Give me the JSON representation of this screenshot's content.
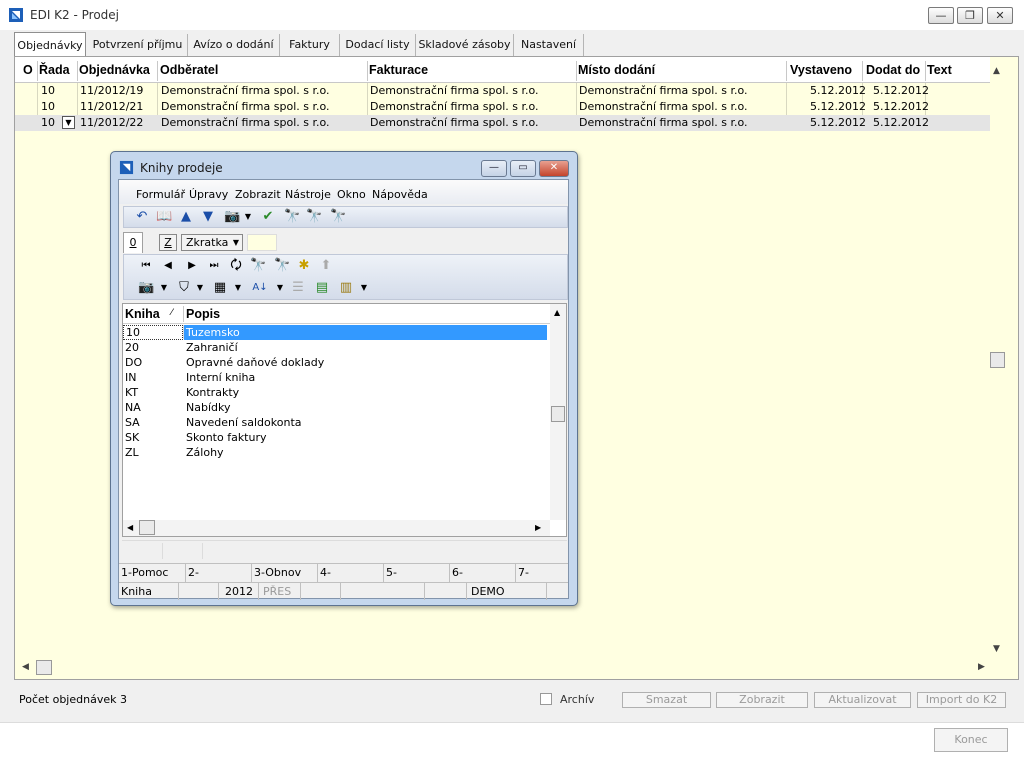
{
  "app": {
    "title": "EDI K2 - Prodej"
  },
  "window_controls": {
    "minimize": "—",
    "restore": "❐",
    "close": "✕"
  },
  "tabs": [
    "Objednávky",
    "Potvrzení příjmu",
    "Avízo o dodání",
    "Faktury",
    "Dodací listy",
    "Skladové zásoby",
    "Nastavení"
  ],
  "grid": {
    "headers": [
      "O",
      "Řada",
      "Objednávka",
      "Odběratel",
      "Fakturace",
      "Místo dodání",
      "Vystaveno",
      "Dodat do",
      "Text"
    ],
    "rows": [
      [
        "",
        "10",
        "11/2012/19",
        "Demonstrační firma spol. s r.o.",
        "Demonstrační firma spol. s r.o.",
        "Demonstrační firma spol. s r.o.",
        "5.12.2012",
        "5.12.2012",
        ""
      ],
      [
        "",
        "10",
        "11/2012/21",
        "Demonstrační firma spol. s r.o.",
        "Demonstrační firma spol. s r.o.",
        "Demonstrační firma spol. s r.o.",
        "5.12.2012",
        "5.12.2012",
        ""
      ],
      [
        "",
        "10",
        "11/2012/22",
        "Demonstrační firma spol. s r.o.",
        "Demonstrační firma spol. s r.o.",
        "Demonstrační firma spol. s r.o.",
        "5.12.2012",
        "5.12.2012",
        ""
      ]
    ]
  },
  "status": {
    "count": "Počet objednávek 3",
    "archiv": "Archív"
  },
  "actions": {
    "smazat": "Smazat",
    "zobrazit": "Zobrazit",
    "aktualizovat": "Aktualizovat",
    "import": "Import do K2"
  },
  "konec": "Konec",
  "dialog": {
    "title": "Knihy prodeje",
    "menu": [
      "Formulář",
      "Úpravy",
      "Zobrazit",
      "Nástroje",
      "Okno",
      "Nápověda"
    ],
    "tab0": "0",
    "z_label": "Z",
    "sort_select": "Zkratka",
    "columns": [
      "Kniha",
      "Popis"
    ],
    "rows": [
      [
        "10",
        "Tuzemsko"
      ],
      [
        "20",
        "Zahraničí"
      ],
      [
        "DO",
        "Opravné daňové doklady"
      ],
      [
        "IN",
        "Interní kniha"
      ],
      [
        "KT",
        "Kontrakty"
      ],
      [
        "NA",
        "Nabídky"
      ],
      [
        "SA",
        "Navedení saldokonta"
      ],
      [
        "SK",
        "Skonto faktury"
      ],
      [
        "ZL",
        "Zálohy"
      ]
    ],
    "fkeys": [
      "1-Pomoc",
      "2-",
      "3-Obnov",
      "4-",
      "5-",
      "6-",
      "7-"
    ],
    "status": [
      "Kniha",
      "2012",
      "PŘES",
      "DEMO"
    ]
  },
  "colors": {
    "grid_bg": "#ffffe1",
    "selection": "#3399ff",
    "dialog_frame": "#c5d7ed"
  }
}
